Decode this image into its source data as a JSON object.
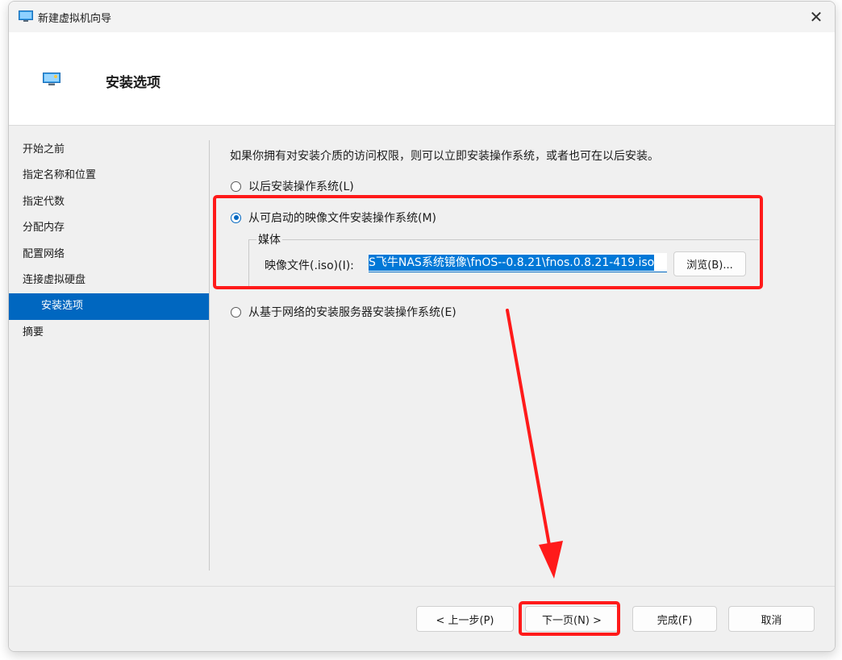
{
  "window": {
    "title": "新建虚拟机向导",
    "close_symbol": "✕"
  },
  "header": {
    "title": "安装选项"
  },
  "nav": {
    "items": [
      {
        "label": "开始之前"
      },
      {
        "label": "指定名称和位置"
      },
      {
        "label": "指定代数"
      },
      {
        "label": "分配内存"
      },
      {
        "label": "配置网络"
      },
      {
        "label": "连接虚拟硬盘"
      },
      {
        "label": "安装选项"
      },
      {
        "label": "摘要"
      }
    ]
  },
  "content": {
    "intro": "如果你拥有对安装介质的访问权限，则可以立即安装操作系统，或者也可在以后安装。",
    "options": [
      {
        "label": "以后安装操作系统(L)",
        "checked": false
      },
      {
        "label": "从可启动的映像文件安装操作系统(M)",
        "checked": true
      },
      {
        "label": "从基于网络的安装服务器安装操作系统(E)",
        "checked": false
      }
    ],
    "media": {
      "legend": "媒体",
      "iso_label": "映像文件(.iso)(I):",
      "iso_value": "S飞牛NAS系统镜像\\fnOS--0.8.21\\fnos.0.8.21-419.iso",
      "browse_label": "浏览(B)..."
    }
  },
  "footer": {
    "prev_label": "< 上一步(P)",
    "next_label": "下一页(N) >",
    "finish_label": "完成(F)",
    "cancel_label": "取消"
  },
  "colors": {
    "accent": "#0067c0",
    "annotation": "#ff1a1a"
  }
}
